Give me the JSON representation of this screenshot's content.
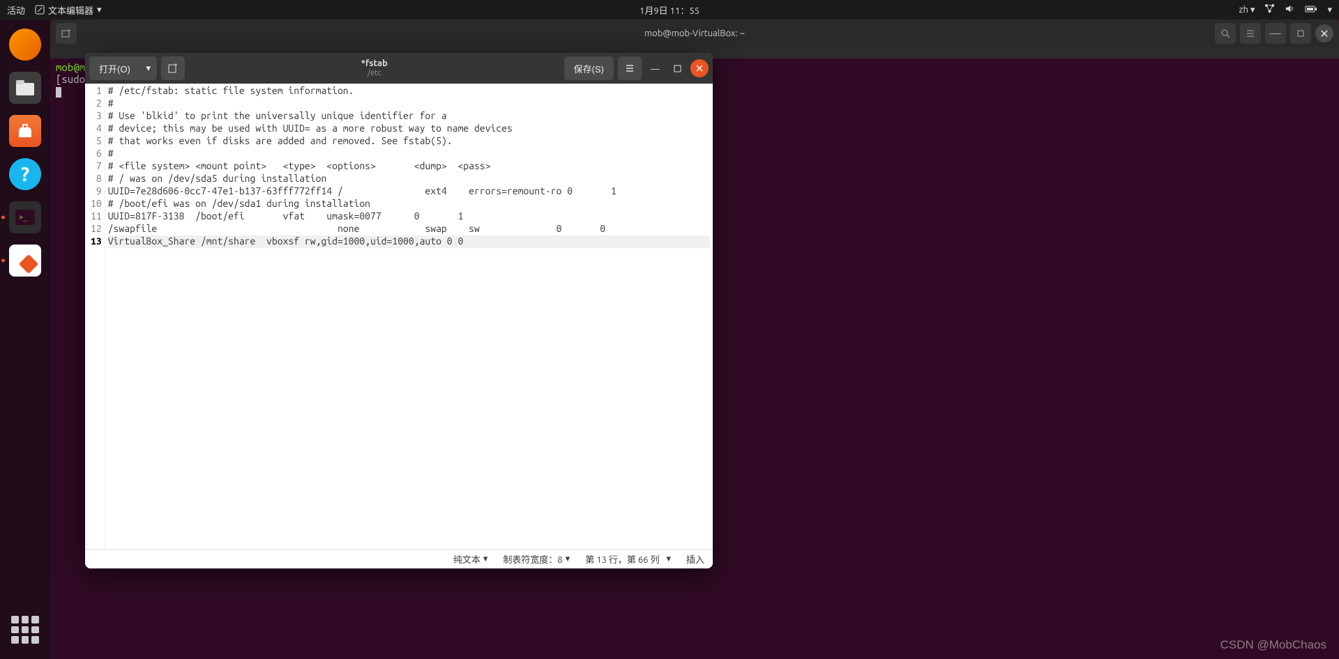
{
  "topbar": {
    "activities": "活动",
    "app_name": "文本编辑器",
    "datetime": "1月9日 11：55",
    "lang": "zh"
  },
  "terminal": {
    "title": "mob@mob-VirtualBox: ~",
    "prompt_line1": "mob@mo",
    "prompt_line2": "[sudo]"
  },
  "gedit": {
    "open_label": "打开(O)",
    "save_label": "保存(S)",
    "title": "*fstab",
    "subtitle": "/etc",
    "lines": [
      "# /etc/fstab: static file system information.",
      "#",
      "# Use 'blkid' to print the universally unique identifier for a",
      "# device; this may be used with UUID= as a more robust way to name devices",
      "# that works even if disks are added and removed. See fstab(5).",
      "#",
      "# <file system> <mount point>   <type>  <options>       <dump>  <pass>",
      "# / was on /dev/sda5 during installation",
      "UUID=7e28d606-0cc7-47e1-b137-63fff772ff14 /               ext4    errors=remount-ro 0       1",
      "# /boot/efi was on /dev/sda1 during installation",
      "UUID=817F-3138  /boot/efi       vfat    umask=0077      0       1",
      "/swapfile                                 none            swap    sw              0       0",
      "VirtualBox_Share /mnt/share  vboxsf rw,gid=1000,uid=1000,auto 0 0"
    ],
    "status": {
      "syntax": "纯文本",
      "tabwidth": "制表符宽度：8",
      "position": "第 13 行，第 66 列",
      "mode": "插入"
    }
  },
  "watermark": "CSDN @MobChaos"
}
